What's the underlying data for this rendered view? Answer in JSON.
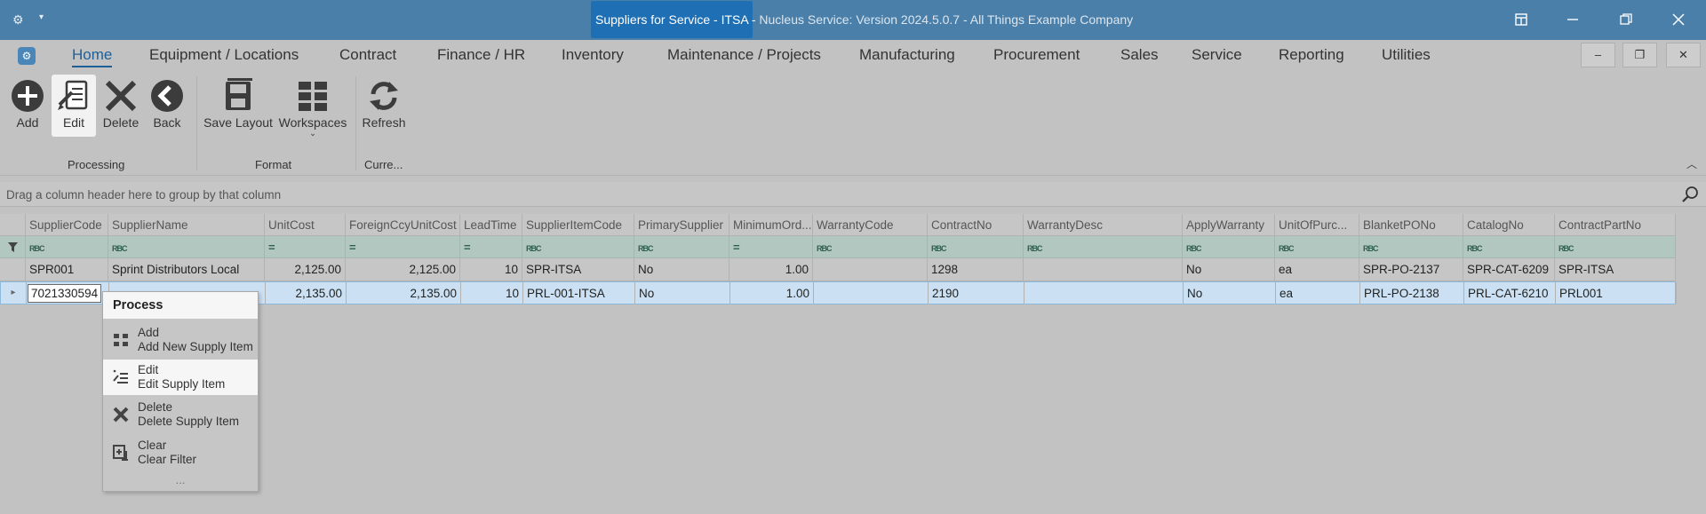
{
  "window": {
    "title_highlight": "Suppliers for Service - ITSA -",
    "title_rest": " Nucleus Service: Version 2024.5.0.7 - All Things Example Company",
    "app_icon": "gear-icon",
    "menu_glyph": "▾"
  },
  "menubar": {
    "items": [
      "Home",
      "Equipment / Locations",
      "Contract",
      "Finance / HR",
      "Inventory",
      "Maintenance / Projects",
      "Manufacturing",
      "Procurement",
      "Sales",
      "Service",
      "Reporting",
      "Utilities"
    ],
    "active": "Home"
  },
  "ribbon": {
    "buttons": {
      "add": "Add",
      "edit": "Edit",
      "delete": "Delete",
      "back": "Back",
      "save_layout": "Save Layout",
      "workspaces": "Workspaces",
      "refresh": "Refresh"
    },
    "groups": {
      "processing": "Processing",
      "format": "Format",
      "current": "Curre..."
    }
  },
  "group_panel": {
    "hint": "Drag a column header here to group by that column"
  },
  "grid": {
    "columns": [
      "SupplierCode",
      "SupplierName",
      "UnitCost",
      "ForeignCcyUnitCost",
      "LeadTime",
      "SupplierItemCode",
      "PrimarySupplier",
      "MinimumOrd...",
      "WarrantyCode",
      "ContractNo",
      "WarrantyDesc",
      "ApplyWarranty",
      "UnitOfPurc...",
      "BlanketPONo",
      "CatalogNo",
      "ContractPartNo"
    ],
    "filter_text_glyph": "RBC",
    "filter_num_glyph": "=",
    "rows": [
      [
        "SPR001",
        "Sprint Distributors Local",
        "2,125.00",
        "2,125.00",
        "10",
        "SPR-ITSA",
        "No",
        "1.00",
        "",
        "1298",
        "",
        "No",
        "ea",
        "SPR-PO-2137",
        "SPR-CAT-6209",
        "SPR-ITSA"
      ],
      [
        "",
        "",
        "2,135.00",
        "2,135.00",
        "10",
        "PRL-001-ITSA",
        "No",
        "1.00",
        "",
        "2190",
        "",
        "No",
        "ea",
        "PRL-PO-2138",
        "PRL-CAT-6210",
        "PRL001"
      ]
    ],
    "editing_value": "7021330594"
  },
  "context_menu": {
    "header": "Process",
    "items": [
      {
        "title": "Add",
        "subtitle": "Add New Supply Item",
        "icon": "grid-add-icon"
      },
      {
        "title": "Edit",
        "subtitle": "Edit Supply Item",
        "icon": "edit-list-icon"
      },
      {
        "title": "Delete",
        "subtitle": "Delete Supply Item",
        "icon": "delete-x-icon"
      },
      {
        "title": "Clear",
        "subtitle": "Clear Filter",
        "icon": "clear-filter-icon"
      }
    ],
    "more": "..."
  },
  "colors": {
    "titlebar": "#4a7fa9",
    "accent": "#1d5f98",
    "selected_row": "#cbe1f3",
    "filter_row": "#b3c7c1"
  }
}
